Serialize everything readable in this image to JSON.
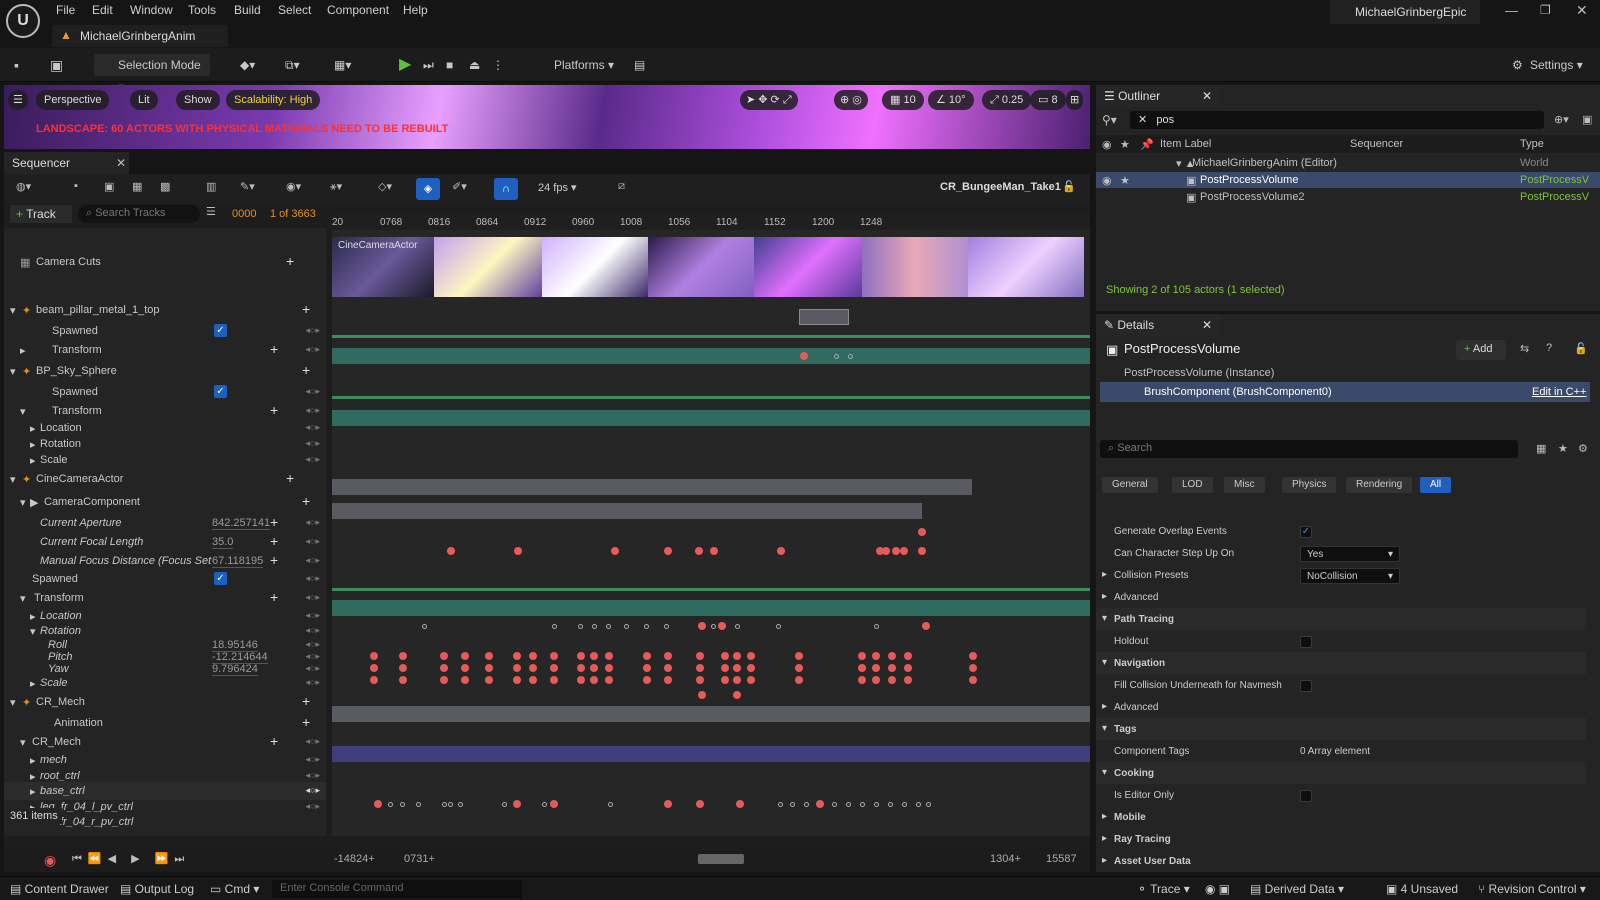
{
  "menu": {
    "items": [
      "File",
      "Edit",
      "Window",
      "Tools",
      "Build",
      "Select",
      "Component",
      "Help"
    ],
    "project_title": "MichaelGrinbergEpic",
    "tab_label": "MichaelGrinbergAnim"
  },
  "toolbar": {
    "selection_mode": "Selection Mode",
    "platforms": "Platforms",
    "settings": "Settings"
  },
  "viewport": {
    "perspective": "Perspective",
    "lit": "Lit",
    "show": "Show",
    "scalability": "Scalability: High",
    "warning": "LANDSCAPE: 60 ACTORS WITH PHYSICAL MATERIALS NEED TO BE REBUILT",
    "grid": "10",
    "angle": "10°",
    "scale": "0.25",
    "cam": "8"
  },
  "sequencer": {
    "tab": "Sequencer",
    "fps": "24 fps",
    "sequence": "CR_BungeeMan_Take1",
    "track_btn": "Track",
    "search_placeholder": "Search Tracks",
    "frame": "0000",
    "frame_count": "1 of 3663",
    "items_count": "361 items",
    "range_start": "-14824+",
    "range_in": "0731+",
    "range_out": "1304+",
    "range_end": "15587",
    "ruler": [
      "20",
      "0768",
      "0816",
      "0864",
      "0912",
      "0960",
      "1008",
      "1056",
      "1104",
      "1152",
      "1200",
      "1248"
    ],
    "thumb_label": "CineCameraActor"
  },
  "tracks": {
    "camera_cuts": "Camera Cuts",
    "beam": "beam_pillar_metal_1_top",
    "spawned": "Spawned",
    "transform": "Transform",
    "sky": "BP_Sky_Sphere",
    "location": "Location",
    "rotation": "Rotation",
    "scale": "Scale",
    "cine": "CineCameraActor",
    "camcomp": "CameraComponent",
    "aperture": "Current Aperture",
    "aperture_val": "842.257141",
    "focal": "Current Focal Length",
    "focal_val": "35.0",
    "focus": "Manual Focus Distance (Focus Set",
    "focus_val": "67.118195",
    "roll": "Roll",
    "roll_val": "18.95146",
    "pitch": "Pitch",
    "pitch_val": "-12.214644",
    "yaw": "Yaw",
    "yaw_val": "9.796424",
    "mech": "CR_Mech",
    "animation": "Animation",
    "mech2": "CR_Mech",
    "bone_mech": "mech",
    "root": "root_ctrl",
    "base": "base_ctrl",
    "leg1": "leg_fr_04_l_pv_ctrl",
    "leg2": "fr_04_r_pv_ctrl"
  },
  "outliner": {
    "tab": "Outliner",
    "search": "pos",
    "col_label": "Item Label",
    "col_seq": "Sequencer",
    "col_type": "Type",
    "root": "MichaelGrinbergAnim (Editor)",
    "root_type": "World",
    "item1": "PostProcessVolume",
    "item2": "PostProcessVolume2",
    "item_type": "PostProcessV",
    "status": "Showing 2 of 105 actors (1 selected)"
  },
  "details": {
    "tab": "Details",
    "title": "PostProcessVolume",
    "add": "Add",
    "instance": "PostProcessVolume (Instance)",
    "brush": "BrushComponent (BrushComponent0)",
    "edit_cpp": "Edit in C++",
    "search_placeholder": "Search",
    "tabs": [
      "General",
      "LOD",
      "Misc",
      "Physics",
      "Rendering",
      "All"
    ],
    "rows": [
      {
        "k": "Generate Overlap Events",
        "type": "check"
      },
      {
        "k": "Can Character Step Up On",
        "type": "select",
        "v": "Yes"
      },
      {
        "k": "Collision Presets",
        "type": "select",
        "v": "NoCollision"
      },
      {
        "k": "Advanced",
        "type": "cat2"
      },
      {
        "k": "Path Tracing",
        "type": "cat"
      },
      {
        "k": "Holdout",
        "type": "box"
      },
      {
        "k": "Navigation",
        "type": "cat"
      },
      {
        "k": "Fill Collision Underneath for Navmesh",
        "type": "box"
      },
      {
        "k": "Advanced",
        "type": "cat2"
      },
      {
        "k": "Tags",
        "type": "cat"
      },
      {
        "k": "Component Tags",
        "type": "text",
        "v": "0 Array element"
      },
      {
        "k": "Cooking",
        "type": "cat"
      },
      {
        "k": "Is Editor Only",
        "type": "box"
      },
      {
        "k": "Mobile",
        "type": "cat3"
      },
      {
        "k": "Ray Tracing",
        "type": "cat3"
      },
      {
        "k": "Asset User Data",
        "type": "cat3"
      }
    ]
  },
  "status": {
    "content_drawer": "Content Drawer",
    "output_log": "Output Log",
    "cmd": "Cmd",
    "console_placeholder": "Enter Console Command",
    "trace": "Trace",
    "derived": "Derived Data",
    "unsaved": "4 Unsaved",
    "revision": "Revision Control"
  },
  "colors": {
    "accent": "#1e5fbf",
    "keyframe": "#e85a5a",
    "warning": "#ff3030",
    "highlight": "#7ec53a"
  }
}
